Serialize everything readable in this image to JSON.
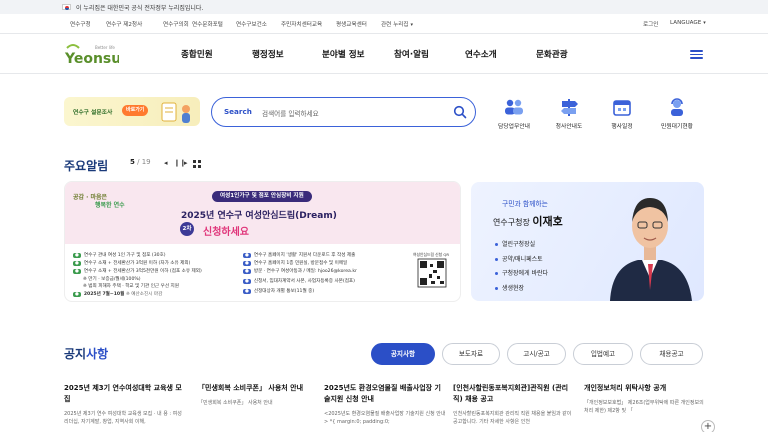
{
  "gov_bar": {
    "text": "이 누리집은 대한민국 공식 전자정부 누리집입니다."
  },
  "util_bar": {
    "items": [
      "연수구청",
      "연수구 제2청사",
      "연수구의회",
      "연수문화포털",
      "연수구보건소",
      "주민자치센터교육",
      "평생교육센터",
      "관련 누리집"
    ],
    "login": "로그인",
    "language": "LANGUAGE"
  },
  "gnb": {
    "logo": "Yeonsu",
    "logo_sub": "Better life",
    "menu": [
      "종합민원",
      "행정정보",
      "분야별 정보",
      "참여·알림",
      "연수소개",
      "문화관광"
    ]
  },
  "survey": {
    "label": "연수구 설문조사",
    "go": "바로가기"
  },
  "search": {
    "label": "Search",
    "placeholder": "검색어를 입력하세요"
  },
  "quick_links": [
    "담당업무안내",
    "청사안내도",
    "행사일정",
    "민원대기현황"
  ],
  "notice": {
    "title_a": "주요",
    "title_b": "알림",
    "current": "5",
    "total": "19",
    "banner": {
      "pill": "여성1인가구 및 점포 안심장비 지원",
      "head1": "2025년 연수구 여성안심드림(Dream)",
      "step": "2차",
      "head2": "신청하세요",
      "brand": "공감 · 마음은",
      "brand2": "행복한 연수",
      "rows": [
        "연수구 관내 여성 1인 가구 및 점포 (30호)",
        "연수구 소재 + 전세환산가 3억원 이하 (자가 소유 제외)",
        "연수구 소재 + 전세환산가 3억5천만원 이하 (점포 소유 제외)",
        "※ 만기 · 보증금/월세(100%)",
        "※ 범죄 피해자 주택 · 학교 및 기관 인근 우선 지원"
      ],
      "period": "2025년 7월~10월",
      "period_note": "※ 예산소진시 마감",
      "rows2": [
        "연수구 홈페이지 '생활' 지원서 다운로드 후 작성 제출",
        "연수구 홈페이지 1층 민원실, 방문접수 및 이메일",
        "방문 · 연수구 여성아동과 / 메일: hjoo26@korea.kr",
        "신청서, 임대차계약서 사본, 사업자등록증 사본(점포)",
        "선정대상자 개별 통보(11월 중)"
      ],
      "qr_caption": "여성안심드림 신청 QR"
    }
  },
  "mayor": {
    "line1": "구민과 함께하는",
    "line2_prefix": "연수구청장",
    "name": "이재호",
    "links": [
      "열린구청장실",
      "공약/매니페스토",
      "구청장에게 바란다",
      "생생현장"
    ]
  },
  "board": {
    "title_a": "공지",
    "title_b": "사항",
    "tabs": [
      "공지사항",
      "보도자료",
      "고시/공고",
      "입법예고",
      "채용공고"
    ],
    "posts": [
      {
        "title": "2025년 제3기 연수여성대학 교육생 모집",
        "desc": "2025년 제3기 연수 여성대학 교육생 모집 · 내 용 : 여성 리더십, 자기계발, 창업, 지역사회 이해,"
      },
      {
        "title": "「민생회복 소비쿠폰」 사용처 안내",
        "desc": "「민생회복 소비쿠폰」 사용처 안내"
      },
      {
        "title": "2025년도 환경오염물질 배출사업장 기술지원 신청 안내",
        "desc": "<2025년도 환경오염물질 배출사업장 기술지원 신청 안내> *{ margin:0; padding:0;"
      },
      {
        "title": "[인천사할린동포복지회관]관직원 (관리직) 채용 공고",
        "desc": "인천사할린동포복지회관 관리직 직원 채용을 붙임과 같이 공고합니다. 기타 자세한 사항은 인천"
      },
      {
        "title": "개인정보처리 위탁사항 공개",
        "desc": "「개인정보보호법」 제26조(업무위탁에 따른 개인정보의 처리 제한) 제2항 및 「"
      }
    ]
  }
}
